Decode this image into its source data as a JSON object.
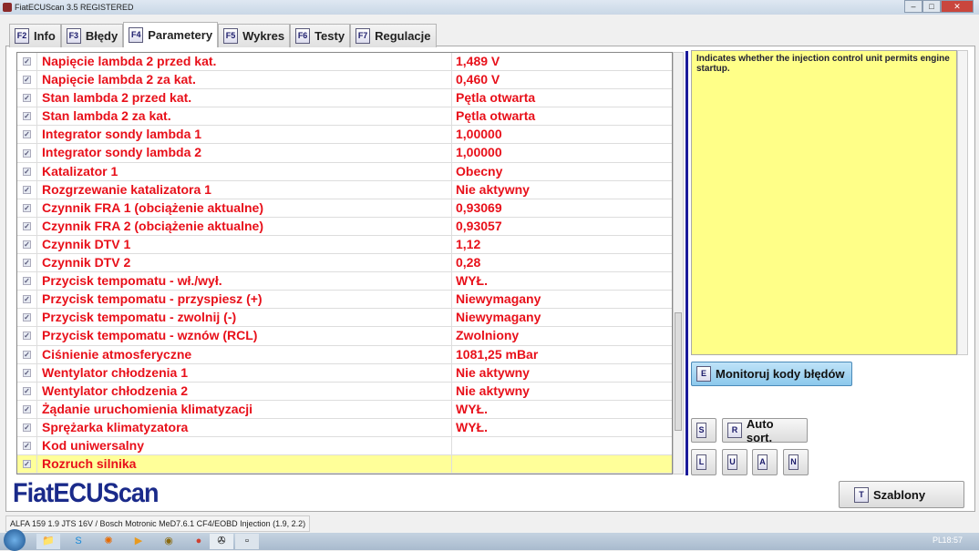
{
  "window": {
    "title": "FiatECUScan 3.5 REGISTERED"
  },
  "tabs": [
    {
      "key": "F2",
      "label": "Info"
    },
    {
      "key": "F3",
      "label": "Błędy"
    },
    {
      "key": "F4",
      "label": "Parametery",
      "active": true
    },
    {
      "key": "F5",
      "label": "Wykres"
    },
    {
      "key": "F6",
      "label": "Testy"
    },
    {
      "key": "F7",
      "label": "Regulacje"
    }
  ],
  "rows": [
    {
      "name": "Napięcie lambda 2 przed kat.",
      "value": "1,489 V"
    },
    {
      "name": "Napięcie lambda 2 za kat.",
      "value": "0,460 V"
    },
    {
      "name": "Stan lambda 2 przed kat.",
      "value": "Pętla otwarta"
    },
    {
      "name": "Stan lambda 2 za kat.",
      "value": "Pętla otwarta"
    },
    {
      "name": "Integrator sondy lambda 1",
      "value": "1,00000"
    },
    {
      "name": "Integrator sondy lambda 2",
      "value": "1,00000"
    },
    {
      "name": "Katalizator 1",
      "value": "Obecny"
    },
    {
      "name": "Rozgrzewanie katalizatora 1",
      "value": "Nie aktywny"
    },
    {
      "name": "Czynnik FRA 1 (obciążenie aktualne)",
      "value": "0,93069"
    },
    {
      "name": "Czynnik FRA 2 (obciążenie aktualne)",
      "value": "0,93057"
    },
    {
      "name": "Czynnik DTV 1",
      "value": "1,12"
    },
    {
      "name": "Czynnik DTV 2",
      "value": "0,28"
    },
    {
      "name": "Przycisk tempomatu - wł./wył.",
      "value": "WYŁ."
    },
    {
      "name": "Przycisk tempomatu - przyspiesz (+)",
      "value": "Niewymagany"
    },
    {
      "name": "Przycisk tempomatu - zwolnij (-)",
      "value": "Niewymagany"
    },
    {
      "name": "Przycisk tempomatu - wznów (RCL)",
      "value": "Zwolniony"
    },
    {
      "name": "Ciśnienie atmosferyczne",
      "value": "1081,25 mBar"
    },
    {
      "name": "Wentylator chłodzenia 1",
      "value": "Nie aktywny"
    },
    {
      "name": "Wentylator chłodzenia 2",
      "value": "Nie aktywny"
    },
    {
      "name": "Żądanie uruchomienia klimatyzacji",
      "value": "WYŁ."
    },
    {
      "name": "Sprężarka klimatyzatora",
      "value": "WYŁ."
    },
    {
      "name": "Kod uniwersalny",
      "value": ""
    },
    {
      "name": "Rozruch silnika",
      "value": "",
      "selected": true
    }
  ],
  "info_text": "Indicates whether the injection control unit permits engine startup.",
  "buttons": {
    "monitor": {
      "key": "E",
      "label": "Monitoruj kody błędów"
    },
    "s": {
      "key": "S"
    },
    "autosort": {
      "key": "R",
      "label": "Auto sort."
    },
    "l": {
      "key": "L"
    },
    "u": {
      "key": "U"
    },
    "a": {
      "key": "A"
    },
    "n": {
      "key": "N"
    },
    "templates": {
      "key": "T",
      "label": "Szablony"
    }
  },
  "logo": "FiatECUScan",
  "status": "ALFA 159 1.9 JTS 16V / Bosch Motronic MeD7.6.1 CF4/EOBD Injection (1.9, 2.2)",
  "taskbar": {
    "lang": "PL",
    "clock": "18:57"
  }
}
